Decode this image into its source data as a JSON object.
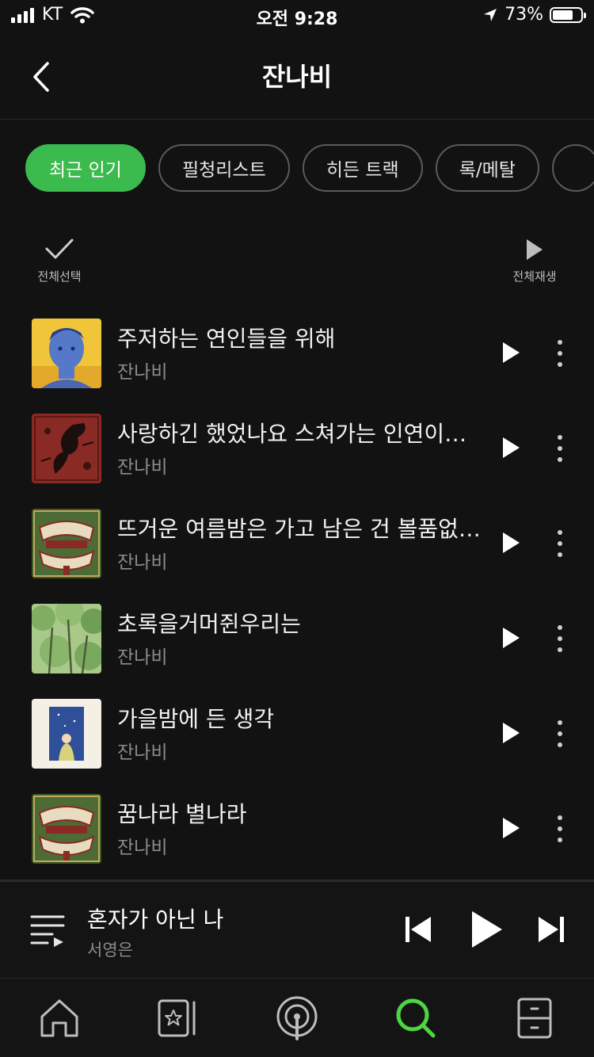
{
  "status_bar": {
    "carrier": "KT",
    "time": "오전 9:28",
    "battery": "73%",
    "battery_level": 0.73
  },
  "header": {
    "title": "잔나비",
    "back_icon": "chevron-left-icon"
  },
  "filters": [
    {
      "label": "최근 인기",
      "selected": true
    },
    {
      "label": "필청리스트",
      "selected": false
    },
    {
      "label": "히든 트랙",
      "selected": false
    },
    {
      "label": "록/메탈",
      "selected": false
    }
  ],
  "actions": {
    "select_all": "전체선택",
    "play_all": "전체재생"
  },
  "tracks": [
    {
      "title": "주저하는 연인들을 위해",
      "artist": "잔나비"
    },
    {
      "title": "사랑하긴 했었나요 스쳐가는 인연이었나요 짧지않은 우리 함께했던 시간들이 자꾸 내 마음을 가둬두네",
      "artist": "잔나비"
    },
    {
      "title": "뜨거운 여름밤은 가고 남은 건 볼품없지만",
      "artist": "잔나비"
    },
    {
      "title": "초록을거머쥔우리는",
      "artist": "잔나비"
    },
    {
      "title": "가을밤에 든 생각",
      "artist": "잔나비"
    },
    {
      "title": "꿈나라 별나라",
      "artist": "잔나비"
    }
  ],
  "now_playing": {
    "title": "혼자가 아닌 나",
    "artist": "서영은"
  },
  "tab_bar": {
    "items": [
      "home-icon",
      "library-icon",
      "podcast-icon",
      "search-icon",
      "storage-icon"
    ],
    "active": "search-icon"
  },
  "colors": {
    "accent": "#3bba4d",
    "background": "#121212",
    "secondary_text": "#8c8c8c"
  }
}
